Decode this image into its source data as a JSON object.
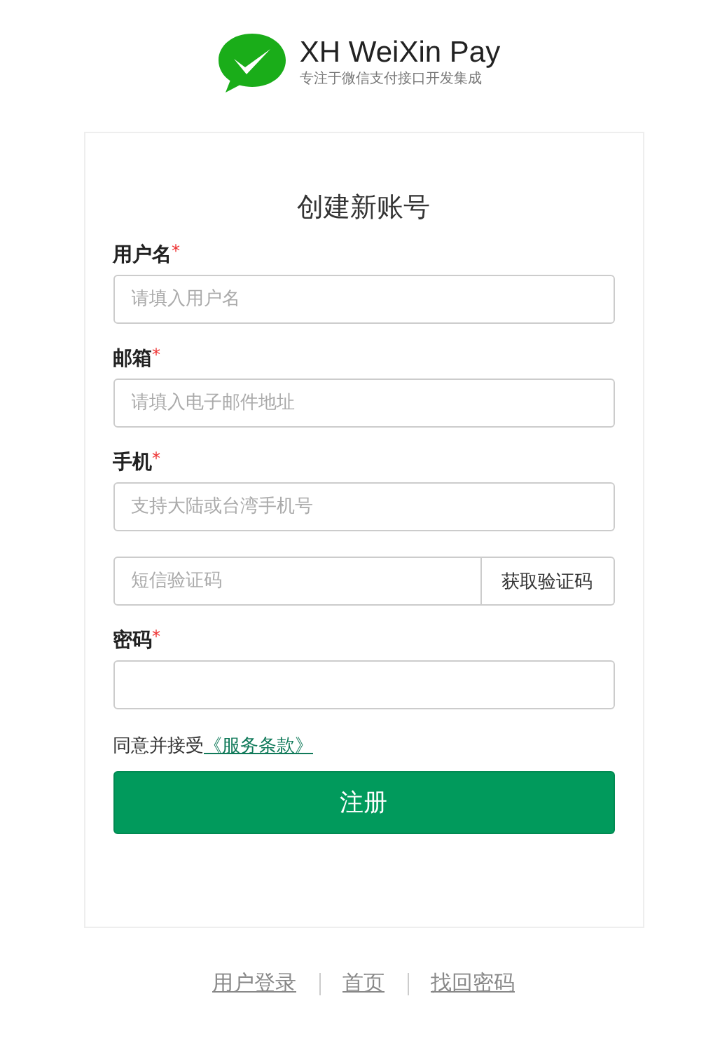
{
  "brand": {
    "name": "XH WeiXin Pay",
    "tagline": "专注于微信支付接口开发集成"
  },
  "form": {
    "title": "创建新账号",
    "fields": [
      {
        "kind": "text",
        "label": "用户名",
        "required_mark": "*",
        "placeholder": "请填入用户名"
      },
      {
        "kind": "text",
        "label": "邮箱",
        "required_mark": "*",
        "placeholder": "请填入电子邮件地址"
      },
      {
        "kind": "text",
        "label": "手机",
        "required_mark": "*",
        "placeholder": "支持大陆或台湾手机号"
      },
      {
        "kind": "sms",
        "placeholder": "短信验证码",
        "button": "获取验证码"
      },
      {
        "kind": "password",
        "label": "密码",
        "required_mark": "*"
      }
    ],
    "agreement": {
      "text": "同意并接受",
      "link": "《服务条款》"
    },
    "submit": "注册"
  },
  "footer_links": [
    "用户登录",
    "首页",
    "找回密码"
  ]
}
